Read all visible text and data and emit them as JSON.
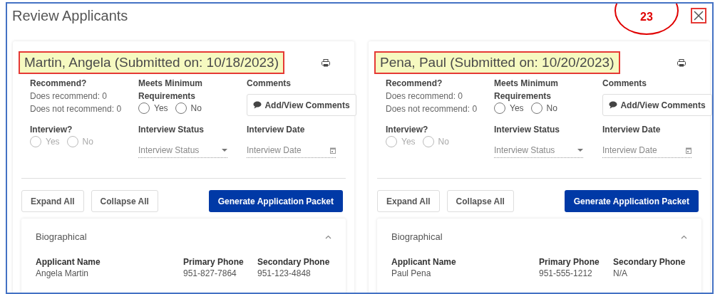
{
  "window": {
    "title": "Review Applicants"
  },
  "annotation": {
    "label": "23"
  },
  "applicants": [
    {
      "header": "Martin, Angela (Submitted on: 10/18/2023)",
      "highlighted": true,
      "recommend": {
        "label": "Recommend?",
        "lines": [
          "Does recommend: 0",
          "Does not recommend: 0"
        ]
      },
      "meets": {
        "label": "Meets Minimum Requirements",
        "options": [
          {
            "label": "Yes",
            "selected": false
          },
          {
            "label": "No",
            "selected": false
          }
        ]
      },
      "comments": {
        "label": "Comments",
        "button": "Add/View Comments"
      },
      "interview": {
        "label": "Interview?",
        "disabled": true,
        "options": [
          {
            "label": "Yes",
            "selected": false
          },
          {
            "label": "No",
            "selected": false
          }
        ]
      },
      "interview_status": {
        "label": "Interview Status",
        "placeholder": "Interview Status"
      },
      "interview_date": {
        "label": "Interview Date",
        "placeholder": "Interview Date"
      },
      "buttons": [
        "Expand All",
        "Collapse All"
      ],
      "primary_button": "Generate Application Packet",
      "section": {
        "title": "Biographical",
        "expanded": true,
        "fields": [
          {
            "label": "Applicant Name",
            "value": "Angela Martin"
          },
          {
            "label": "Primary Phone",
            "value": "951-827-7864"
          },
          {
            "label": "Secondary Phone",
            "value": "951-123-4848"
          }
        ]
      }
    },
    {
      "header": "Pena, Paul (Submitted on: 10/20/2023)",
      "highlighted": true,
      "recommend": {
        "label": "Recommend?",
        "lines": [
          "Does recommend: 0",
          "Does not recommend: 0"
        ]
      },
      "meets": {
        "label": "Meets Minimum Requirements",
        "options": [
          {
            "label": "Yes",
            "selected": false
          },
          {
            "label": "No",
            "selected": false
          }
        ]
      },
      "comments": {
        "label": "Comments",
        "button": "Add/View Comments"
      },
      "interview": {
        "label": "Interview?",
        "disabled": true,
        "options": [
          {
            "label": "Yes",
            "selected": false
          },
          {
            "label": "No",
            "selected": false
          }
        ]
      },
      "interview_status": {
        "label": "Interview Status",
        "placeholder": "Interview Status"
      },
      "interview_date": {
        "label": "Interview Date",
        "placeholder": "Interview Date"
      },
      "buttons": [
        "Expand All",
        "Collapse All"
      ],
      "primary_button": "Generate Application Packet",
      "section": {
        "title": "Biographical",
        "expanded": true,
        "fields": [
          {
            "label": "Applicant Name",
            "value": "Paul Pena"
          },
          {
            "label": "Primary Phone",
            "value": "951-555-1212"
          },
          {
            "label": "Secondary Phone",
            "value": "N/A"
          }
        ]
      }
    }
  ]
}
